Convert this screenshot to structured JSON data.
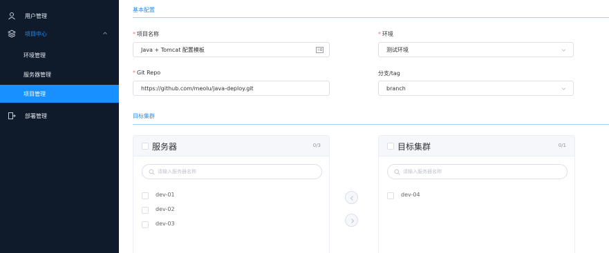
{
  "sidebar": {
    "items": [
      {
        "label": "用户管理",
        "icon": "user-icon"
      },
      {
        "label": "项目中心",
        "icon": "layers-icon",
        "expanded": true
      },
      {
        "label": "环境管理"
      },
      {
        "label": "服务器管理"
      },
      {
        "label": "项目管理",
        "active": true
      },
      {
        "label": "部署管理",
        "icon": "deploy-icon"
      }
    ]
  },
  "form": {
    "section_basic": "基本配置",
    "project_name": {
      "label": "项目名称",
      "value": "Java + Tomcat 配置模板"
    },
    "environment": {
      "label": "环境",
      "value": "测试环境"
    },
    "git_repo": {
      "label": "Git Repo",
      "value": "https://github.com/meolu/java-deploy.git"
    },
    "branch": {
      "label": "分支/tag",
      "value": "branch"
    },
    "section_target": "目标集群"
  },
  "transfer": {
    "left": {
      "title": "服务器",
      "count": "0/3",
      "search_placeholder": "请输入服务器名称",
      "items": [
        "dev-01",
        "dev-02",
        "dev-03"
      ]
    },
    "right": {
      "title": "目标集群",
      "count": "0/1",
      "search_placeholder": "请输入服务器名称",
      "items": [
        "dev-04"
      ]
    }
  },
  "colors": {
    "accent": "#1890ff",
    "sidebar_bg": "#0f1a2b",
    "required": "#f56c6c"
  }
}
